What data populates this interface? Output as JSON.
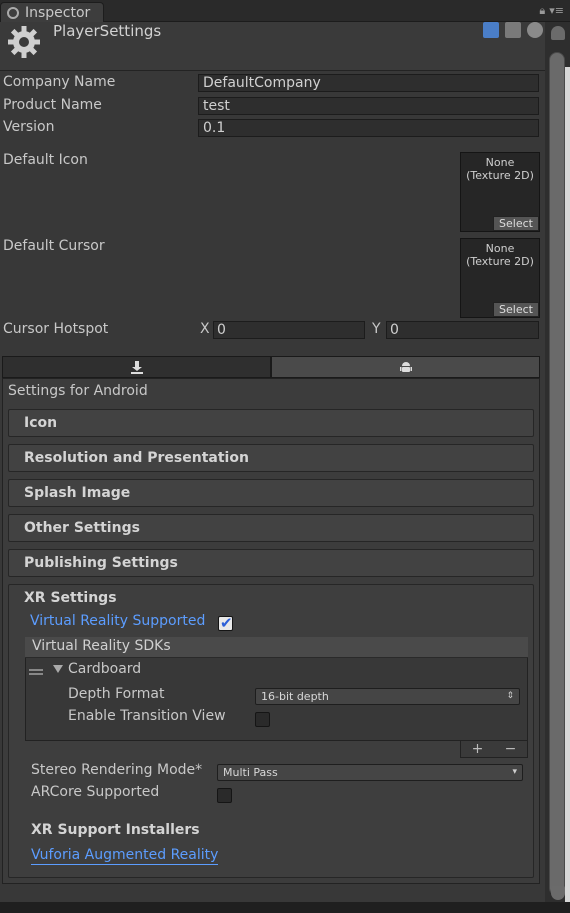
{
  "tab": {
    "title": "Inspector"
  },
  "header": {
    "title": "PlayerSettings"
  },
  "fields": {
    "company_name": {
      "label": "Company Name",
      "value": "DefaultCompany"
    },
    "product_name": {
      "label": "Product Name",
      "value": "test"
    },
    "version": {
      "label": "Version",
      "value": "0.1"
    }
  },
  "default_icon": {
    "label": "Default Icon",
    "object_line1": "None",
    "object_line2": "(Texture 2D)",
    "select_label": "Select"
  },
  "default_cursor": {
    "label": "Default Cursor",
    "object_line1": "None",
    "object_line2": "(Texture 2D)",
    "select_label": "Select"
  },
  "cursor_hotspot": {
    "label": "Cursor Hotspot",
    "x_label": "X",
    "x_value": "0",
    "y_label": "Y",
    "y_value": "0"
  },
  "platform": {
    "settings_for": "Settings for Android",
    "active_tab": "android"
  },
  "sections": [
    "Icon",
    "Resolution and Presentation",
    "Splash Image",
    "Other Settings",
    "Publishing Settings"
  ],
  "xr": {
    "title": "XR Settings",
    "vr_supported_label": "Virtual Reality Supported",
    "vr_supported_checked": true,
    "sdk_list_header": "Virtual Reality SDKs",
    "sdk_name": "Cardboard",
    "depth_format_label": "Depth Format",
    "depth_format_value": "16-bit depth",
    "enable_transition_label": "Enable Transition View",
    "enable_transition_checked": false,
    "stereo_mode_label": "Stereo Rendering Mode*",
    "stereo_mode_value": "Multi Pass",
    "arcore_label": "ARCore Supported",
    "arcore_checked": false,
    "installers_title": "XR Support Installers",
    "vuforia_link": "Vuforia Augmented Reality"
  },
  "colors": {
    "background": "#383838",
    "link": "#5c9dff",
    "field": "#2e2e2e"
  }
}
